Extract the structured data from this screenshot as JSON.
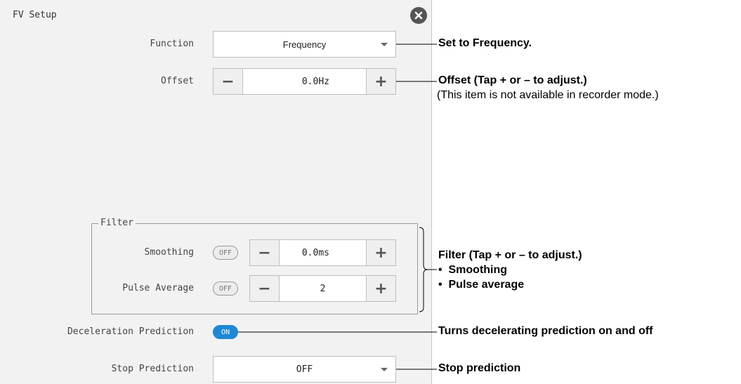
{
  "dialog": {
    "title": "FV Setup",
    "close_icon": "close-circle-icon"
  },
  "fields": {
    "function": {
      "label": "Function",
      "value": "Frequency"
    },
    "offset": {
      "label": "Offset",
      "value": "0.0Hz"
    },
    "filter": {
      "legend": "Filter",
      "smoothing": {
        "label": "Smoothing",
        "toggle": "OFF",
        "value": "0.0ms"
      },
      "pulse_average": {
        "label": "Pulse Average",
        "toggle": "OFF",
        "value": "2"
      }
    },
    "deceleration_prediction": {
      "label": "Deceleration Prediction",
      "toggle": "ON"
    },
    "stop_prediction": {
      "label": "Stop Prediction",
      "value": "OFF"
    }
  },
  "stepper_symbols": {
    "minus": "−",
    "plus": "+"
  },
  "annotations": {
    "function": "Set to Frequency.",
    "offset": "Offset (Tap + or – to adjust.)",
    "offset_note": "(This item is not available in recorder mode.)",
    "filter": "Filter (Tap + or – to adjust.)",
    "filter_items": [
      "Smoothing",
      "Pulse average"
    ],
    "deceleration": "Turns decelerating prediction on and off",
    "stop": "Stop prediction"
  },
  "colors": {
    "toggle_on": "#1e88d6",
    "panel_bg": "#f2f2f2"
  }
}
